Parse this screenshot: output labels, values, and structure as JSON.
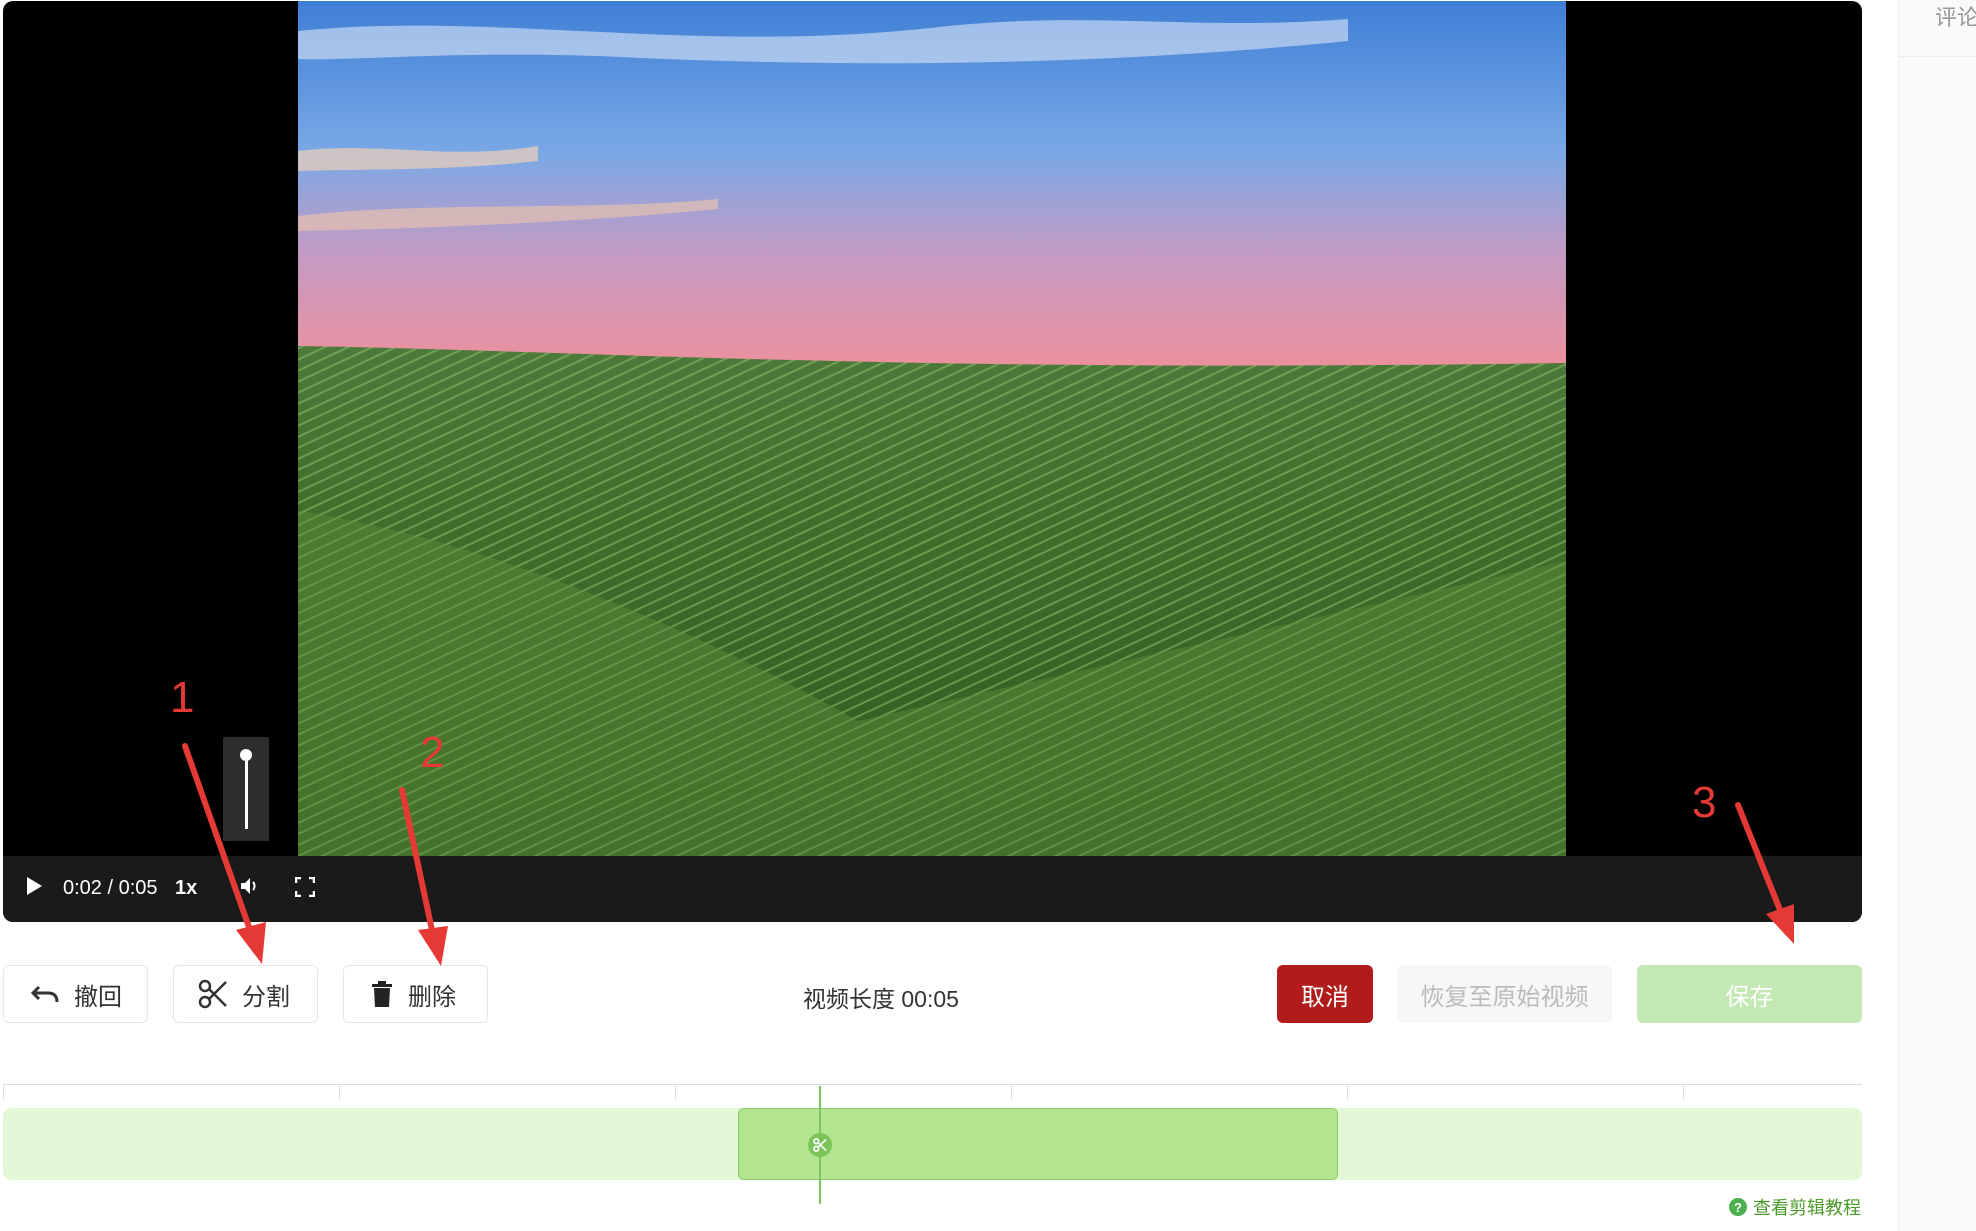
{
  "side_panel": {
    "tab_label": "评论"
  },
  "player": {
    "time_display": "0:02 / 0:05",
    "speed": "1x",
    "icons": [
      "play-icon",
      "volume-icon",
      "fullscreen-icon"
    ]
  },
  "toolbar": {
    "undo_label": "撤回",
    "split_label": "分割",
    "delete_label": "删除",
    "duration_text": "视频长度 00:05",
    "cancel_label": "取消",
    "restore_label": "恢复至原始视频",
    "save_label": "保存"
  },
  "timeline": {
    "tutorial_link": "查看剪辑教程"
  },
  "annotations": [
    "1",
    "2",
    "3"
  ],
  "colors": {
    "cancel_bg": "#b01b1b",
    "save_bg_disabled": "#c4e8b4",
    "track_bg": "#e3f8d6",
    "selected_segment": "#b3e48f",
    "annotation": "#e53935"
  }
}
